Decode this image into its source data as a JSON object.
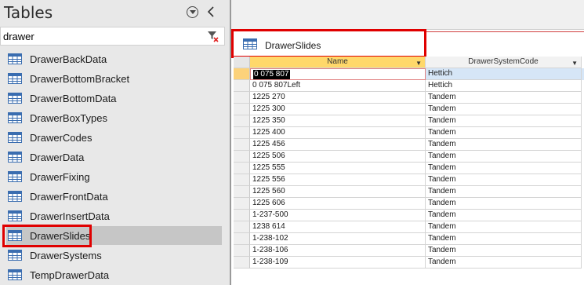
{
  "nav": {
    "title": "Tables",
    "search_value": "drawer",
    "items": [
      {
        "label": "DrawerBackData"
      },
      {
        "label": "DrawerBottomBracket"
      },
      {
        "label": "DrawerBottomData"
      },
      {
        "label": "DrawerBoxTypes"
      },
      {
        "label": "DrawerCodes"
      },
      {
        "label": "DrawerData"
      },
      {
        "label": "DrawerFixing"
      },
      {
        "label": "DrawerFrontData"
      },
      {
        "label": "DrawerInsertData"
      },
      {
        "label": "DrawerSlides"
      },
      {
        "label": "DrawerSystems"
      },
      {
        "label": "TempDrawerData"
      }
    ],
    "selected_item": "DrawerSlides"
  },
  "document": {
    "tab_label": "DrawerSlides",
    "columns": [
      "Name",
      "DrawerSystemCode"
    ],
    "rows": [
      {
        "name": "0 075 807",
        "code": "Hettich"
      },
      {
        "name": "0 075 807Left",
        "code": "Hettich"
      },
      {
        "name": "1225 270",
        "code": "Tandem"
      },
      {
        "name": "1225 300",
        "code": "Tandem"
      },
      {
        "name": "1225 350",
        "code": "Tandem"
      },
      {
        "name": "1225 400",
        "code": "Tandem"
      },
      {
        "name": "1225 456",
        "code": "Tandem"
      },
      {
        "name": "1225 506",
        "code": "Tandem"
      },
      {
        "name": "1225 555",
        "code": "Tandem"
      },
      {
        "name": "1225 556",
        "code": "Tandem"
      },
      {
        "name": "1225 560",
        "code": "Tandem"
      },
      {
        "name": "1225 606",
        "code": "Tandem"
      },
      {
        "name": "1-237-500",
        "code": "Tandem"
      },
      {
        "name": "1238 614",
        "code": "Tandem"
      },
      {
        "name": "1-238-102",
        "code": "Tandem"
      },
      {
        "name": "1-238-106",
        "code": "Tandem"
      },
      {
        "name": "1-238-109",
        "code": "Tandem"
      }
    ]
  },
  "colors": {
    "highlight_red": "#e00000",
    "header_active": "#ffd86a",
    "row_selected": "#d6e6f7",
    "nav_background": "#e8e8e8"
  },
  "icons": [
    "table-icon",
    "dropdown-circle-icon",
    "collapse-chevron-icon",
    "clear-filter-icon",
    "sort-dropdown-icon"
  ]
}
